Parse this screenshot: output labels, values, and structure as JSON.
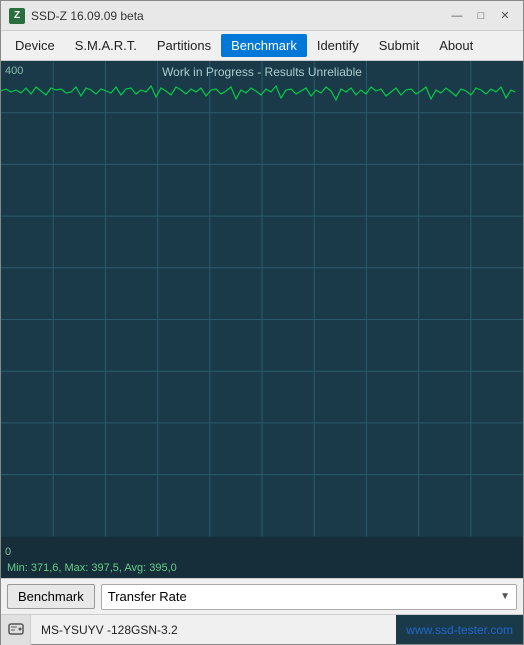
{
  "window": {
    "title": "SSD-Z 16.09.09 beta",
    "icon_label": "Z"
  },
  "titlebar": {
    "minimize_label": "—",
    "maximize_label": "□",
    "close_label": "✕"
  },
  "menu": {
    "items": [
      {
        "id": "device",
        "label": "Device"
      },
      {
        "id": "smart",
        "label": "S.M.A.R.T."
      },
      {
        "id": "partitions",
        "label": "Partitions"
      },
      {
        "id": "benchmark",
        "label": "Benchmark"
      },
      {
        "id": "identify",
        "label": "Identify"
      },
      {
        "id": "submit",
        "label": "Submit"
      },
      {
        "id": "about",
        "label": "About"
      }
    ],
    "active": "benchmark"
  },
  "chart": {
    "title": "Work in Progress - Results Unreliable",
    "y_max": "400",
    "y_min": "0",
    "stats": "Min: 371,6, Max: 397,5, Avg: 395,0",
    "grid_color": "#2a5a6a",
    "line_color": "#00cc44"
  },
  "toolbar": {
    "benchmark_label": "Benchmark",
    "dropdown_value": "Transfer Rate",
    "dropdown_arrow": "▼"
  },
  "statusbar": {
    "device_name": "MS-YSUYV -128GSN-3.2",
    "link_text": "www.ssd-tester.com"
  }
}
